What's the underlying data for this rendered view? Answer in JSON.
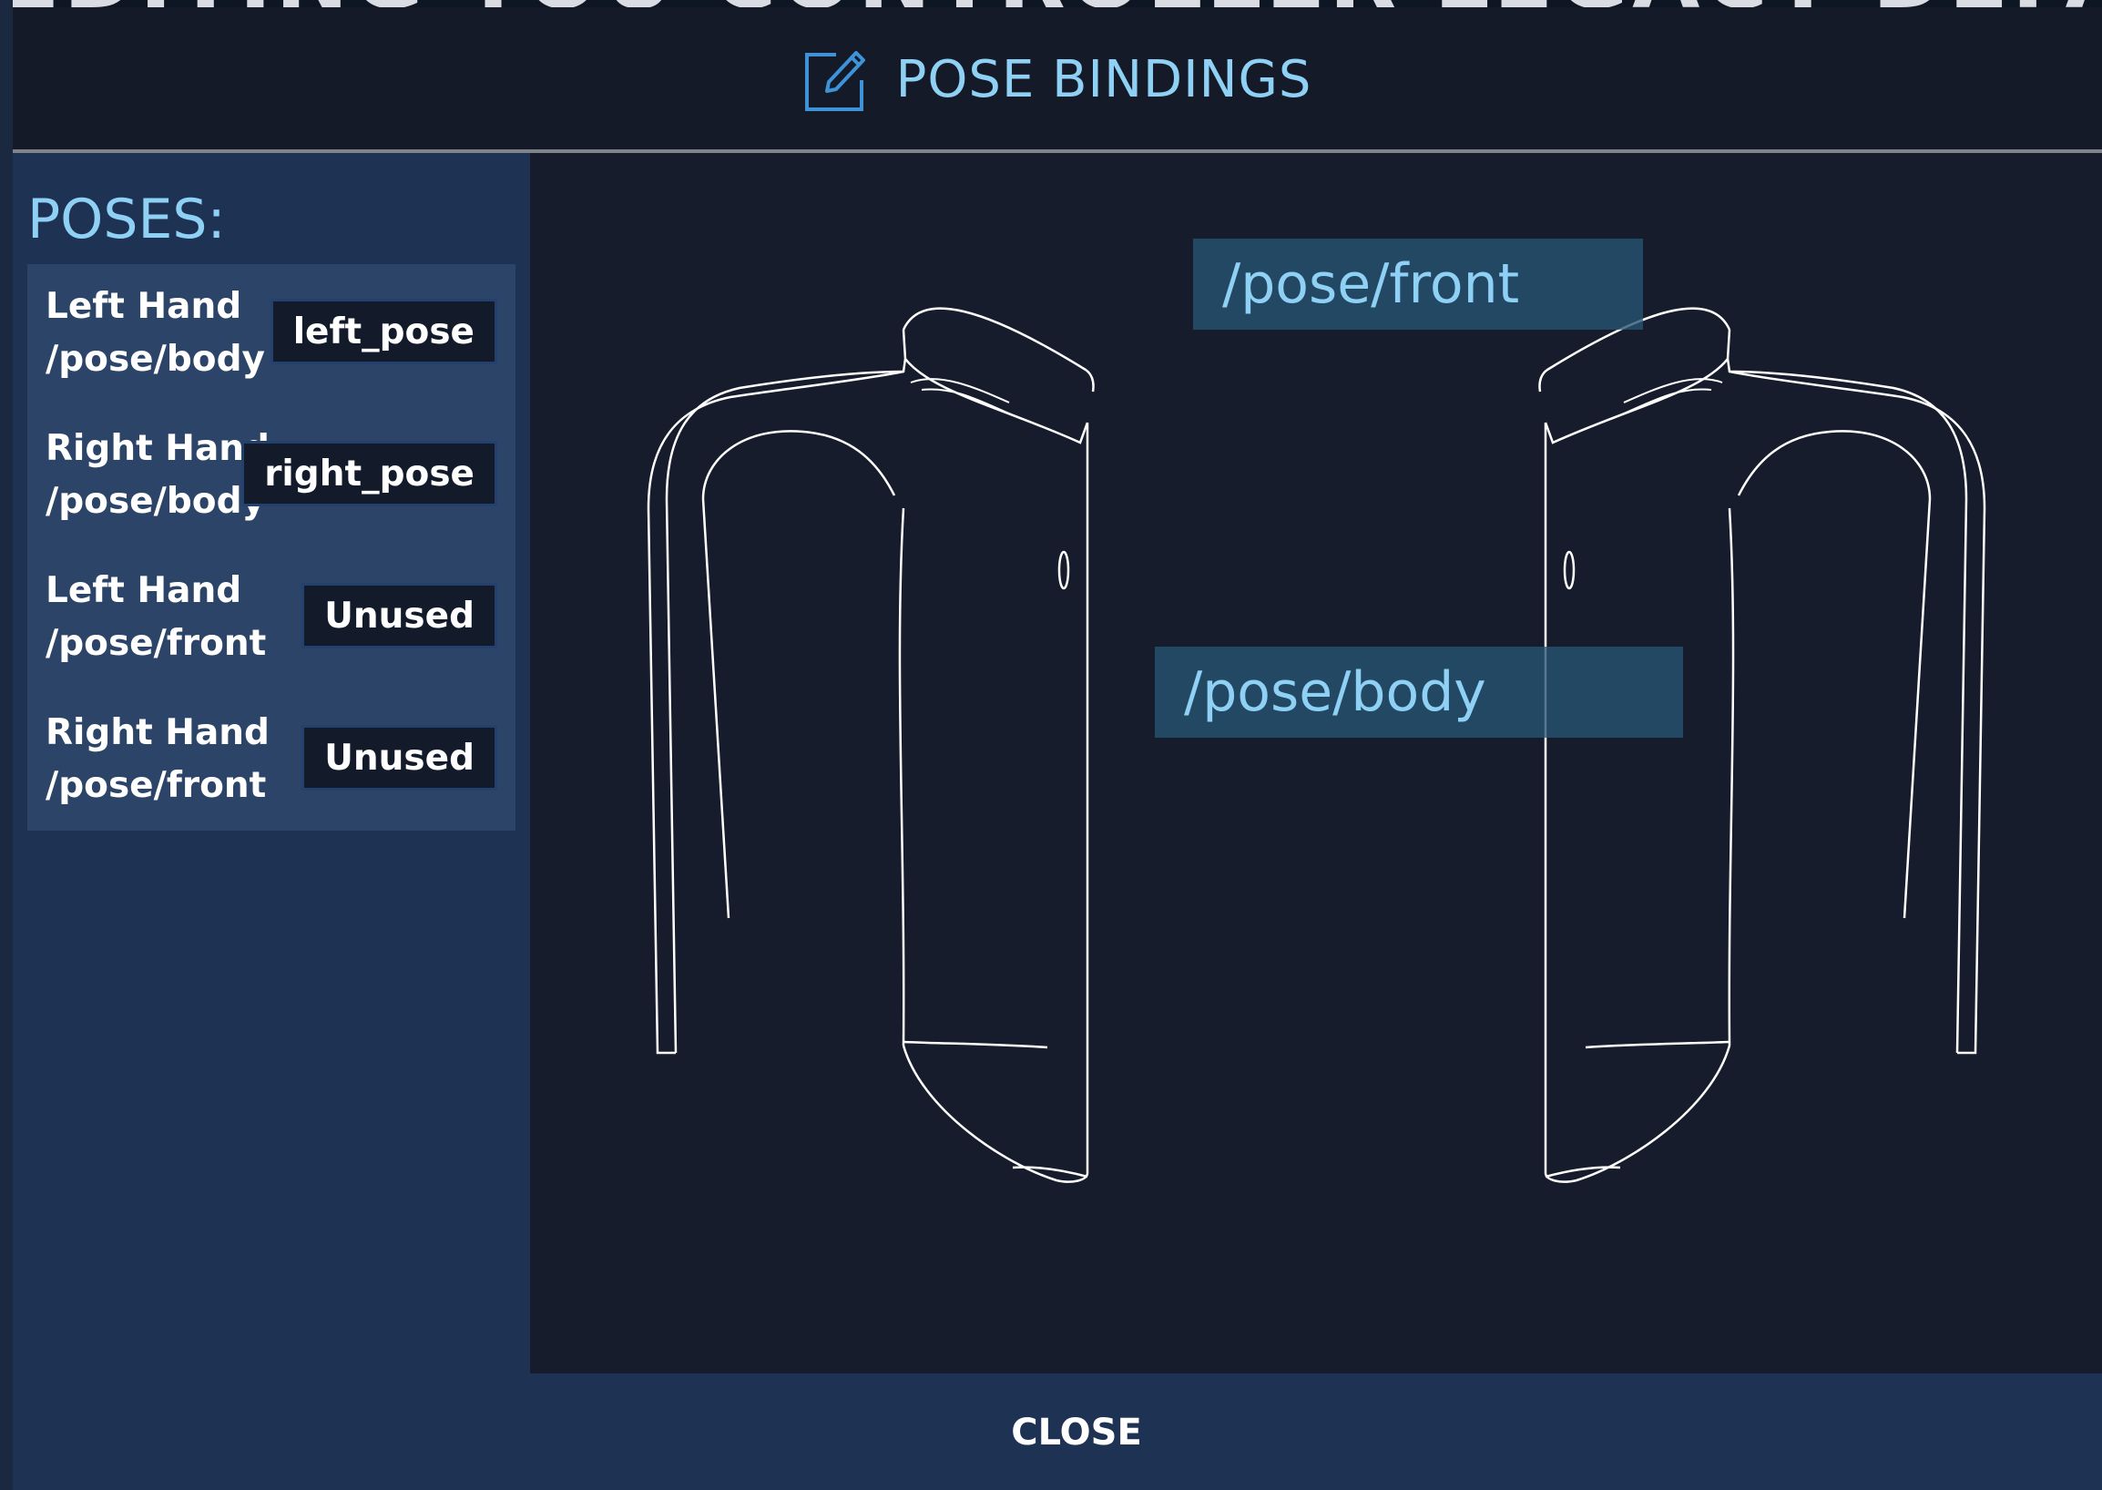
{
  "background": {
    "title": "EDITING YOU CONTROLLER LEGACY DEFAULTS"
  },
  "header": {
    "icon": "edit-icon",
    "title": "POSE BINDINGS"
  },
  "sidebar": {
    "heading": "POSES:",
    "poses": [
      {
        "hand": "Left Hand",
        "path": "/pose/body",
        "binding": "left_pose"
      },
      {
        "hand": "Right Hand",
        "path": "/pose/body",
        "binding": "right_pose"
      },
      {
        "hand": "Left Hand",
        "path": "/pose/front",
        "binding": "Unused"
      },
      {
        "hand": "Right Hand",
        "path": "/pose/front",
        "binding": "Unused"
      }
    ]
  },
  "viewport": {
    "tags": {
      "front": "/pose/front",
      "body": "/pose/body"
    }
  },
  "footer": {
    "close_label": "CLOSE"
  },
  "colors": {
    "accent": "#8fd0f5",
    "modal_bg": "#161c2b",
    "sidebar_bg": "#1e3353",
    "list_bg": "#2b4468",
    "button_bg": "#131b2b"
  }
}
